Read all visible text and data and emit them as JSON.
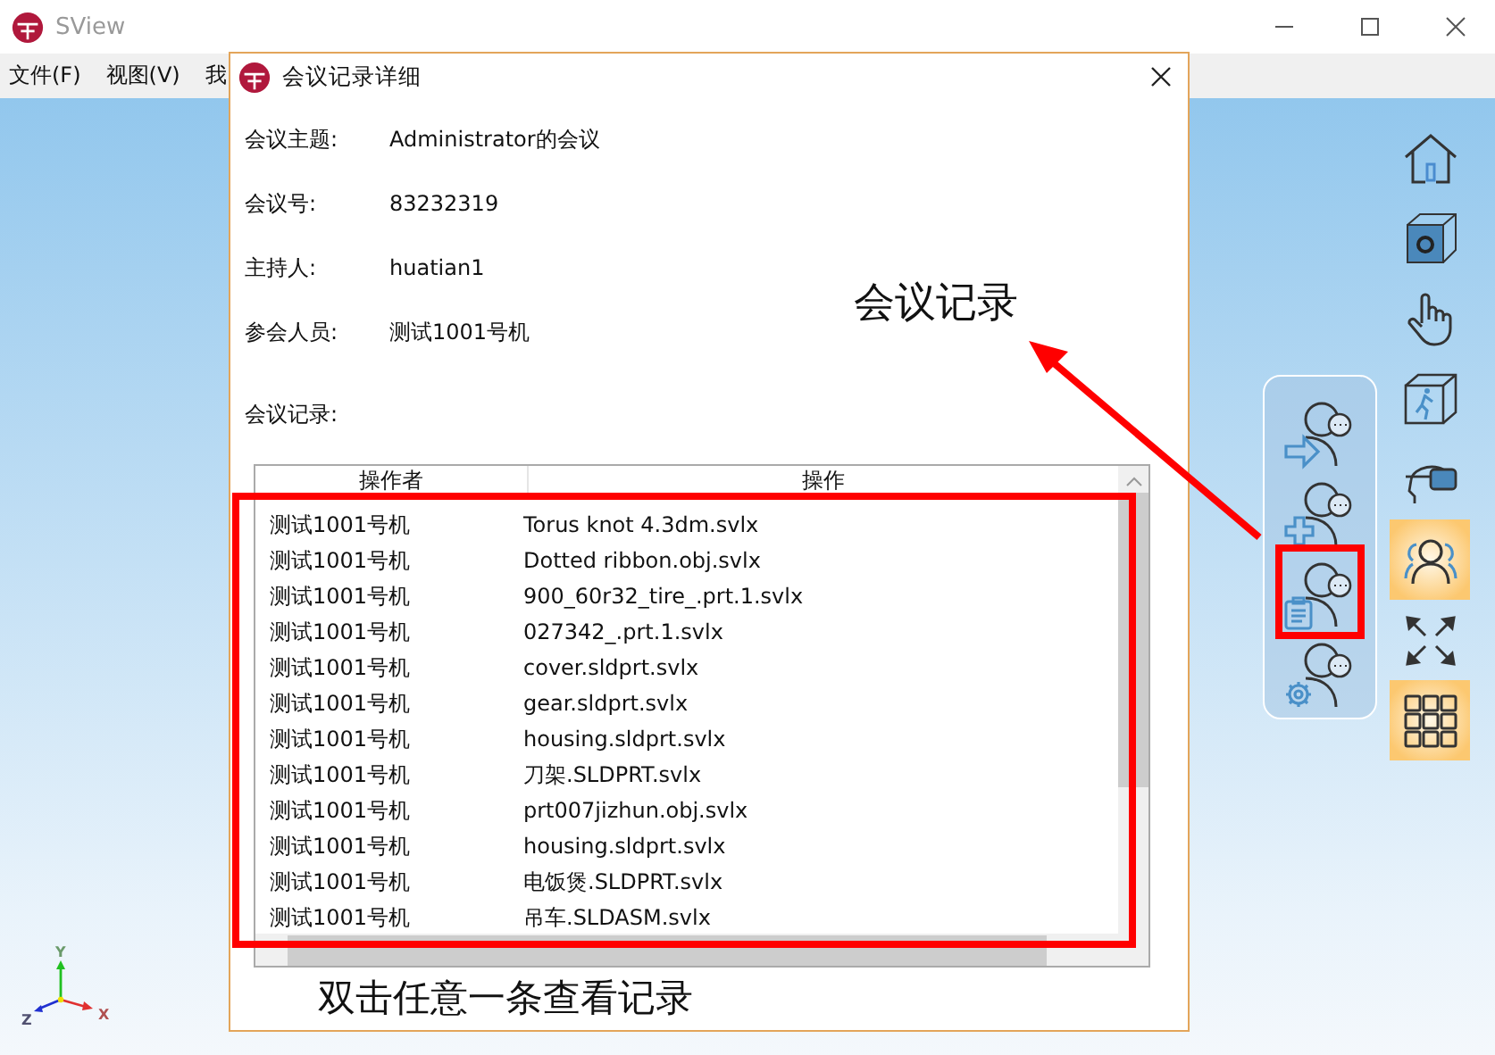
{
  "app": {
    "title": "SView",
    "menu": [
      "文件(F)",
      "视图(V)",
      "我"
    ]
  },
  "toolbar": [
    {
      "kind": "home",
      "selected": false
    },
    {
      "kind": "box-gear",
      "selected": false
    },
    {
      "kind": "hand",
      "selected": false
    },
    {
      "kind": "box-walker",
      "selected": false
    },
    {
      "kind": "vr-headset",
      "selected": false
    },
    {
      "kind": "people",
      "selected": true
    },
    {
      "kind": "arrows",
      "selected": false
    },
    {
      "kind": "grid",
      "selected": true
    }
  ],
  "meeting_menu": [
    {
      "kind": "arrow"
    },
    {
      "kind": "plus"
    },
    {
      "kind": "clipboard"
    },
    {
      "kind": "gear"
    }
  ],
  "axes": {
    "labels": [
      "Y",
      "X",
      "Z"
    ]
  },
  "dialog": {
    "title": "会议记录详细",
    "fields": [
      {
        "label": "会议主题:",
        "value": "Administrator的会议"
      },
      {
        "label": "会议号:",
        "value": "83232319"
      },
      {
        "label": "主持人:",
        "value": "huatian1"
      },
      {
        "label": "参会人员:",
        "value": "测试1001号机"
      }
    ],
    "records_label": "会议记录:",
    "table": {
      "columns": [
        "操作者",
        "操作"
      ],
      "rows": [
        [
          "测试1001号机",
          "Torus knot 4.3dm.svlx"
        ],
        [
          "测试1001号机",
          "Dotted ribbon.obj.svlx"
        ],
        [
          "测试1001号机",
          "900_60r32_tire_.prt.1.svlx"
        ],
        [
          "测试1001号机",
          "027342_.prt.1.svlx"
        ],
        [
          "测试1001号机",
          "cover.sldprt.svlx"
        ],
        [
          "测试1001号机",
          "gear.sldprt.svlx"
        ],
        [
          "测试1001号机",
          "housing.sldprt.svlx"
        ],
        [
          "测试1001号机",
          "刀架.SLDPRT.svlx"
        ],
        [
          "测试1001号机",
          "prt007jizhun.obj.svlx"
        ],
        [
          "测试1001号机",
          "housing.sldprt.svlx"
        ],
        [
          "测试1001号机",
          "电饭煲.SLDPRT.svlx"
        ],
        [
          "测试1001号机",
          "吊车.SLDASM.svlx"
        ]
      ]
    }
  },
  "annotations": {
    "callout": "会议记录",
    "caption": "双击任意一条查看记录"
  }
}
